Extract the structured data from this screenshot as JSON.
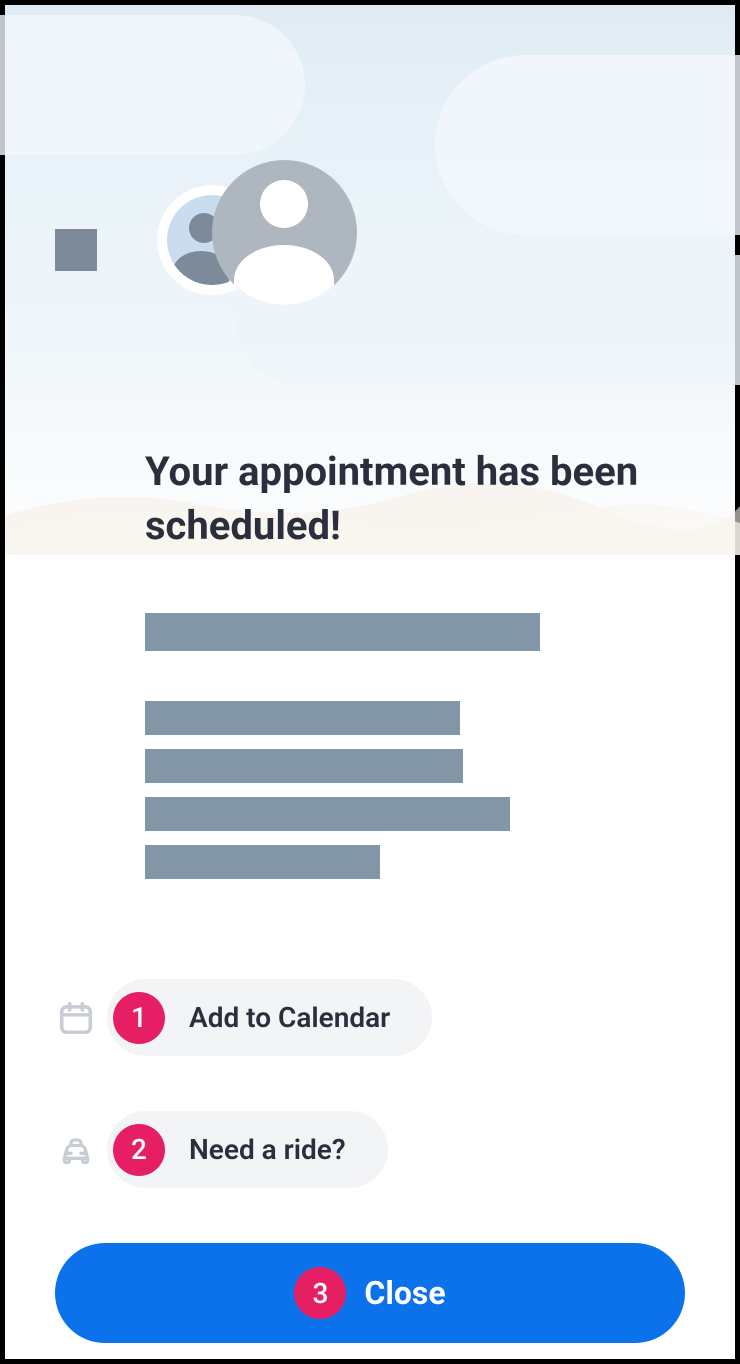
{
  "heading": "Your appointment has been scheduled!",
  "actions": {
    "calendar": {
      "badge": "1",
      "label": "Add to Calendar"
    },
    "ride": {
      "badge": "2",
      "label": "Need a ride?"
    },
    "close": {
      "badge": "3",
      "label": "Close"
    }
  }
}
